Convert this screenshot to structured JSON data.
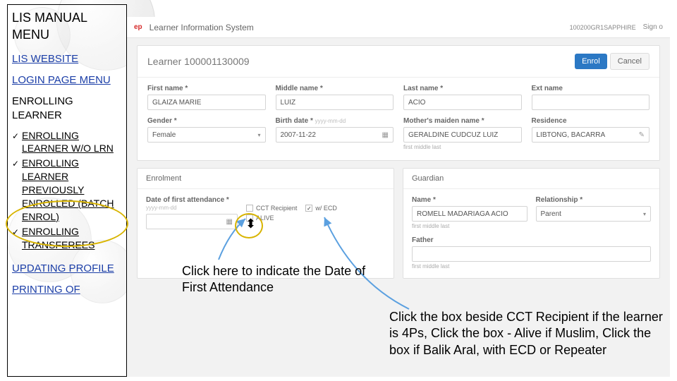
{
  "sidebar": {
    "title": "LIS MANUAL MENU",
    "items": [
      {
        "label": "LIS WEBSITE"
      },
      {
        "label": "LOGIN PAGE MENU"
      }
    ],
    "heading": "ENROLLING LEARNER",
    "list": [
      {
        "label": "ENROLLING LEARNER W/O LRN"
      },
      {
        "label": "ENROLLING LEARNER PREVIOUSLY ENROLLED (BATCH ENROL)"
      },
      {
        "label": "ENROLLING TRANSFEREES"
      }
    ],
    "footer_links": [
      {
        "label": "UPDATING PROFILE"
      },
      {
        "label": "PRINTING OF"
      }
    ]
  },
  "app": {
    "brand": "Learner Information System",
    "user": "100200GR1SAPPHIRE",
    "signout": "Sign o",
    "dep": "ep"
  },
  "panel": {
    "title_prefix": "Learner",
    "title_id": "100001130009",
    "enrol": "Enrol",
    "cancel": "Cancel"
  },
  "fields": {
    "first_name": {
      "label": "First name *",
      "value": "GLAIZA MARIE"
    },
    "middle_name": {
      "label": "Middle name *",
      "value": "LUIZ"
    },
    "last_name": {
      "label": "Last name *",
      "value": "ACIO"
    },
    "ext_name": {
      "label": "Ext name",
      "value": ""
    },
    "gender": {
      "label": "Gender *",
      "value": "Female"
    },
    "birth_date": {
      "label": "Birth date *",
      "placeholder": "yyyy-mm-dd",
      "value": "2007-11-22"
    },
    "maiden": {
      "label": "Mother's maiden name *",
      "value": "GERALDINE CUDCUZ LUIZ",
      "sub": "first middle last"
    },
    "residence": {
      "label": "Residence",
      "value": "LIBTONG, BACARRA"
    }
  },
  "enrolment": {
    "title": "Enrolment",
    "dof_label": "Date of first attendance *",
    "dof_placeholder": "yyyy-mm-dd",
    "cct": "CCT Recipient",
    "ecd": "w/ ECD",
    "alive": "ALIVE",
    "ecd_checked": "✓"
  },
  "guardian": {
    "title": "Guardian",
    "name_label": "Name *",
    "name_value": "ROMELL MADARIAGA ACIO",
    "name_sub": "first middle last",
    "rel_label": "Relationship *",
    "rel_value": "Parent",
    "father_label": "Father",
    "father_sub": "first middle last"
  },
  "annot": {
    "a1": "Click here to indicate the Date of First Attendance",
    "a2": "Click the box beside CCT Recipient if the learner is 4Ps, Click the box - Alive if Muslim, Click the box if Balik Aral, with ECD or Repeater"
  }
}
